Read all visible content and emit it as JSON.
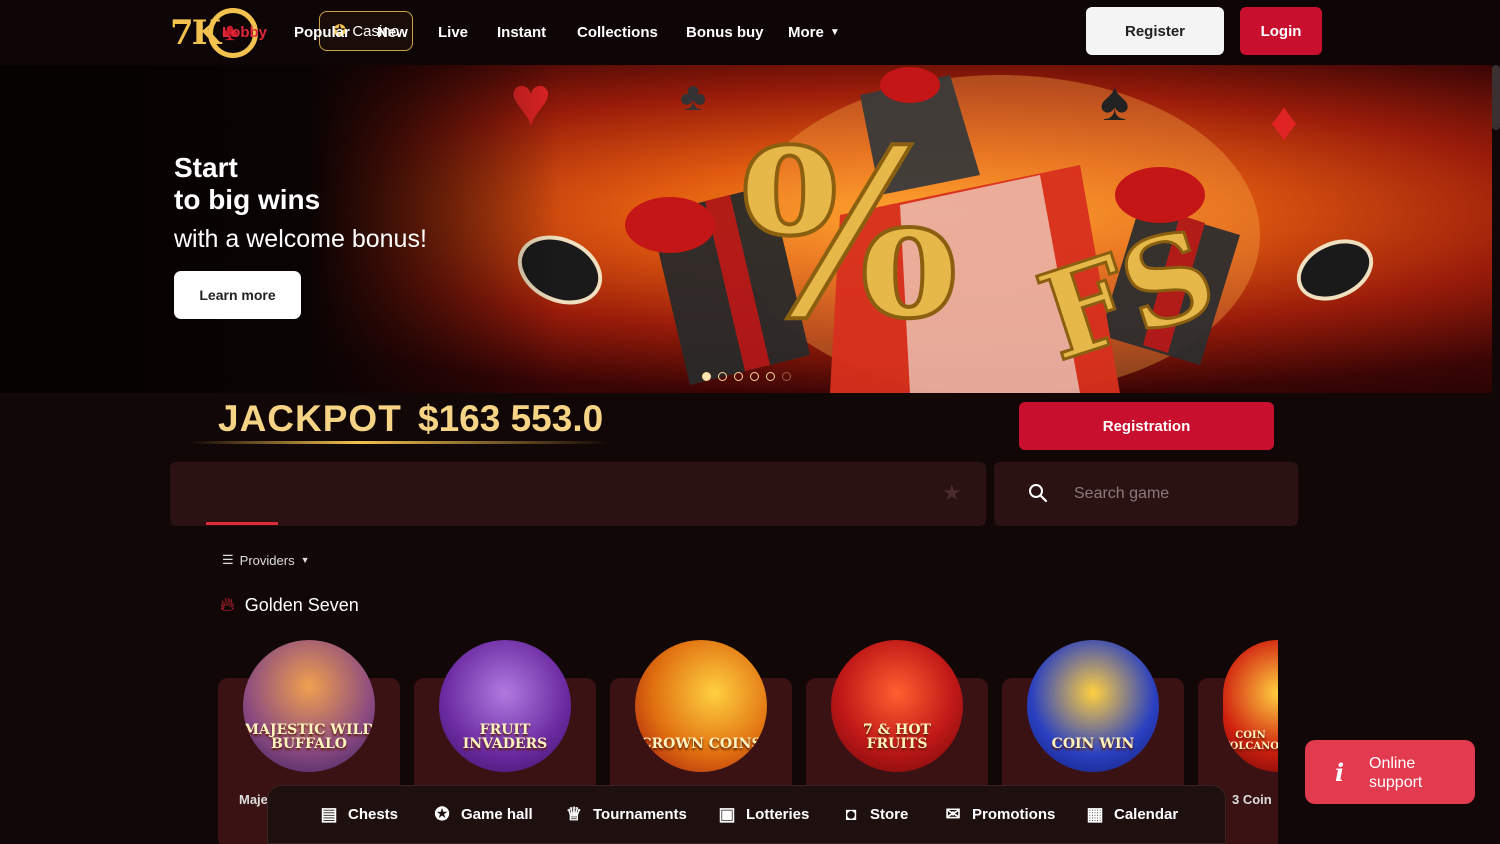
{
  "header": {
    "logo_text": "7K",
    "casino_label": "Casino",
    "register_label": "Register",
    "login_label": "Login"
  },
  "banner": {
    "line1": "Start",
    "line2": "to big wins",
    "line3": "with a welcome bonus!",
    "cta_label": "Learn more",
    "art_text_percent": "%",
    "art_text_fs": "FS",
    "slides_total": 6,
    "active_slide": 1
  },
  "jackpot": {
    "label": "JACKPOT",
    "value": "$163 553.0"
  },
  "registration_label": "Registration",
  "tabs": [
    {
      "label": "Lobby",
      "active": true
    },
    {
      "label": "Popular"
    },
    {
      "label": "New"
    },
    {
      "label": "Live"
    },
    {
      "label": "Instant"
    },
    {
      "label": "Collections"
    },
    {
      "label": "Bonus buy"
    },
    {
      "label": "More"
    }
  ],
  "search": {
    "placeholder": "Search game"
  },
  "providers_label": "Providers",
  "section": {
    "title": "Golden Seven"
  },
  "games": [
    {
      "art_text": "MAJESTIC WILD BUFFALO",
      "title": "Maje"
    },
    {
      "art_text": "FRUIT INVADERS",
      "title": ""
    },
    {
      "art_text": "CROWN COINS",
      "title": ""
    },
    {
      "art_text": "7 & HOT FRUITS",
      "title": ""
    },
    {
      "art_text": "COIN WIN",
      "title": ""
    },
    {
      "art_text": "COIN VOLCANO",
      "title": "3 Coin"
    }
  ],
  "bottom_nav": [
    {
      "label": "Chests",
      "icon": "chest-icon"
    },
    {
      "label": "Game hall",
      "icon": "chip-icon"
    },
    {
      "label": "Tournaments",
      "icon": "trophy-icon"
    },
    {
      "label": "Lotteries",
      "icon": "ticket-icon"
    },
    {
      "label": "Store",
      "icon": "bag-icon"
    },
    {
      "label": "Promotions",
      "icon": "gift-icon"
    },
    {
      "label": "Calendar",
      "icon": "calendar-icon"
    }
  ],
  "support": {
    "label": "Online support"
  },
  "colors": {
    "accent_red": "#c8102e",
    "gold": "#f2c14e",
    "background": "#120707"
  }
}
